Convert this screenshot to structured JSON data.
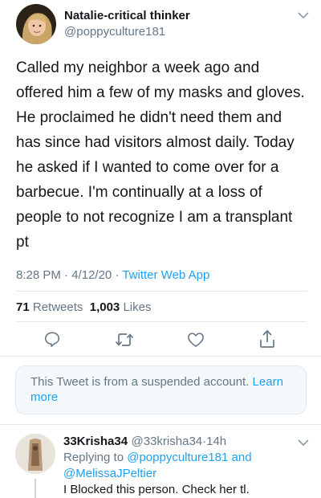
{
  "tweet": {
    "author_name": "Natalie-critical thinker",
    "author_handle": "@poppyculture181",
    "text": "Called my neighbor a week ago and offered him a few of my masks and gloves. He proclaimed he didn't need them and has since had visitors almost daily. Today he asked if I wanted to come over for a barbecue. I'm continually at a loss of people to not recognize I am a transplant pt",
    "time": "8:28 PM",
    "date": "4/12/20",
    "separator": "·",
    "source": "Twitter Web App",
    "retweets_count": "71",
    "retweets_label": "Retweets",
    "likes_count": "1,003",
    "likes_label": "Likes",
    "menu_icon": "chevron-down-icon"
  },
  "actions": {
    "icons": [
      "reply-icon",
      "retweet-icon",
      "like-icon",
      "share-icon"
    ]
  },
  "notice": {
    "text": "This Tweet is from a suspended account.",
    "link": "Learn more"
  },
  "reply": {
    "author_name": "33Krisha34",
    "author_handle": "@33krisha34",
    "separator": "·",
    "time_ago": "14h",
    "replying_prefix": "Replying to",
    "replying_to_1": "@poppyculture181",
    "replying_and": "and",
    "replying_to_2": "@MelissaJPeltier",
    "text": "I Blocked this person. Check her tl."
  },
  "colors": {
    "accent": "#1da1f2",
    "secondary_text": "#657786",
    "divider": "#e1e8ed"
  }
}
